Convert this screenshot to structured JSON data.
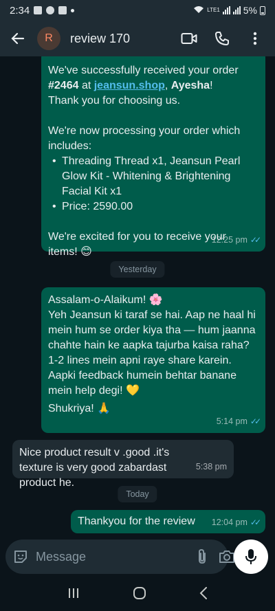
{
  "status_bar": {
    "time": "2:34",
    "battery": "5%",
    "network": "LTE1"
  },
  "header": {
    "avatar_letter": "R",
    "contact_name": "review 170"
  },
  "messages": {
    "order": {
      "line1": "We've successfully received your order",
      "order_no": "#2464",
      "at": " at ",
      "shop_link": "jeansun.shop",
      "comma": ", ",
      "customer": "Ayesha",
      "excl": "!",
      "thanks": "Thank you for choosing us.",
      "processing": "We're now processing your order which includes:",
      "items": [
        "Threading Thread x1, Jeansun Pearl Glow Kit - Whitening & Brightening Facial Kit x1",
        "Price: 2590.00"
      ],
      "excited": "We're excited for you to receive your items! 😊",
      "time": "12:25 pm"
    },
    "yesterday_label": "Yesterday",
    "feedback": {
      "greeting": "Assalam-o-Alaikum! 🌸",
      "body": "Yeh Jeansun ki taraf se hai. Aap ne haal hi mein hum se order kiya tha — hum jaanna chahte hain ke aapka tajurba kaisa raha?",
      "ask": "1-2 lines mein apni raye share karein. Aapki feedback humein behtar banane mein help degi! 💛",
      "closing": "Shukriya! 🙏",
      "time": "5:14 pm"
    },
    "customer_reply": {
      "text": "Nice product result v .good .it's texture is very good zabardast product he.",
      "time": "5:38 pm"
    },
    "today_label": "Today",
    "thanks_reply": {
      "text": "Thankyou for the review",
      "time": "12:04 pm"
    }
  },
  "input": {
    "placeholder": "Message"
  },
  "colors": {
    "outgoing": "#005c4b",
    "incoming": "#202c33",
    "background": "#0b141a",
    "read_ticks": "#53bdeb"
  }
}
